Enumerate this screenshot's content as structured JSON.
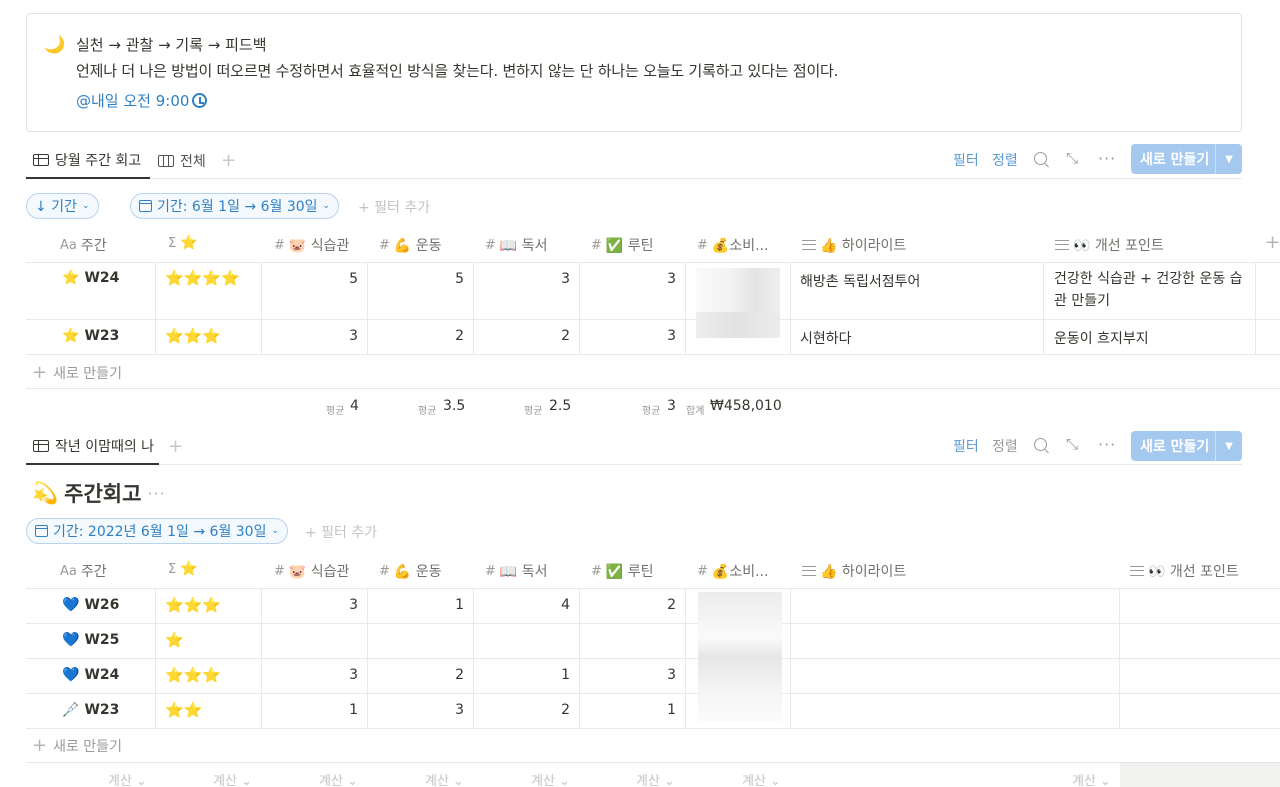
{
  "callout": {
    "icon": "🌙",
    "line1": "실천 → 관찰 → 기록 → 피드백",
    "line2": "언제나 더 나은 방법이 떠오르면 수정하면서 효율적인 방식을 찾는다. 변하지 않는 단 하나는 오늘도 기록하고 있다는 점이다.",
    "reminder": "@내일 오전 9:00"
  },
  "db1": {
    "tabs": [
      {
        "label": "당월 주간 회고",
        "active": true
      },
      {
        "label": "전체",
        "active": false
      }
    ],
    "toolbar": {
      "filter": "필터",
      "sort": "정렬",
      "new": "새로 만들기"
    },
    "filters": {
      "sort_pill": "↓ 기간",
      "date_pill": "기간: 6월 1일 → 6월 30일",
      "add_filter": "+ 필터 추가"
    },
    "headers": {
      "week": {
        "pre": "Aa",
        "label": "주간"
      },
      "stars": {
        "pre": "Σ",
        "label": "⭐"
      },
      "diet": {
        "pre": "#",
        "label": "🐷 식습관"
      },
      "exercise": {
        "pre": "#",
        "label": "💪 운동"
      },
      "reading": {
        "pre": "#",
        "label": "📖 독서"
      },
      "routine": {
        "pre": "#",
        "label": "✅ 루틴"
      },
      "spending": {
        "pre": "#",
        "label": "💰소비..."
      },
      "highlight": {
        "label": "👍 하이라이트"
      },
      "improve": {
        "label": "👀 개선 포인트"
      }
    },
    "rows": [
      {
        "icon": "⭐",
        "week": "W24",
        "stars": "⭐⭐⭐⭐",
        "diet": "5",
        "exercise": "5",
        "reading": "3",
        "routine": "3",
        "highlight": "해방촌 독립서점투어",
        "improve": "건강한 식습관 + 건강한 운동 습관 만들기"
      },
      {
        "icon": "⭐",
        "week": "W23",
        "stars": "⭐⭐⭐",
        "diet": "3",
        "exercise": "2",
        "reading": "2",
        "routine": "3",
        "highlight": "시현하다",
        "improve": "운동이 흐지부지"
      }
    ],
    "new_row": "새로 만들기",
    "footer": {
      "avg_label": "평균",
      "sum_label": "합계",
      "diet_avg": "4",
      "exercise_avg": "3.5",
      "reading_avg": "2.5",
      "routine_avg": "3",
      "spending_sum": "₩458,010"
    }
  },
  "db2": {
    "tabs": [
      {
        "label": "작년 이맘때의 나",
        "active": true
      }
    ],
    "toolbar": {
      "filter": "필터",
      "sort": "정렬",
      "new": "새로 만들기"
    },
    "title": {
      "icon": "💫",
      "text": "주간회고"
    },
    "filters": {
      "date_pill": "기간: 2022년 6월 1일 → 6월 30일",
      "add_filter": "+ 필터 추가"
    },
    "headers": {
      "week": {
        "pre": "Aa",
        "label": "주간"
      },
      "stars": {
        "pre": "Σ",
        "label": "⭐"
      },
      "diet": {
        "pre": "#",
        "label": "🐷 식습관"
      },
      "exercise": {
        "pre": "#",
        "label": "💪 운동"
      },
      "reading": {
        "pre": "#",
        "label": "📖 독서"
      },
      "routine": {
        "pre": "#",
        "label": "✅ 루틴"
      },
      "spending": {
        "pre": "#",
        "label": "💰소비..."
      },
      "highlight": {
        "label": "👍 하이라이트"
      },
      "improve": {
        "label": "👀 개선 포인트"
      }
    },
    "rows": [
      {
        "icon": "💙",
        "week": "W26",
        "stars": "⭐⭐⭐",
        "diet": "3",
        "exercise": "1",
        "reading": "4",
        "routine": "2"
      },
      {
        "icon": "💙",
        "week": "W25",
        "stars": "⭐",
        "diet": "",
        "exercise": "",
        "reading": "",
        "routine": ""
      },
      {
        "icon": "💙",
        "week": "W24",
        "stars": "⭐⭐⭐",
        "diet": "3",
        "exercise": "2",
        "reading": "1",
        "routine": "3"
      },
      {
        "icon": "🩼",
        "week": "W23",
        "stars": "⭐⭐",
        "diet": "1",
        "exercise": "3",
        "reading": "2",
        "routine": "1"
      }
    ],
    "new_row": "새로 만들기",
    "calc_label": "계산 ⌄"
  }
}
